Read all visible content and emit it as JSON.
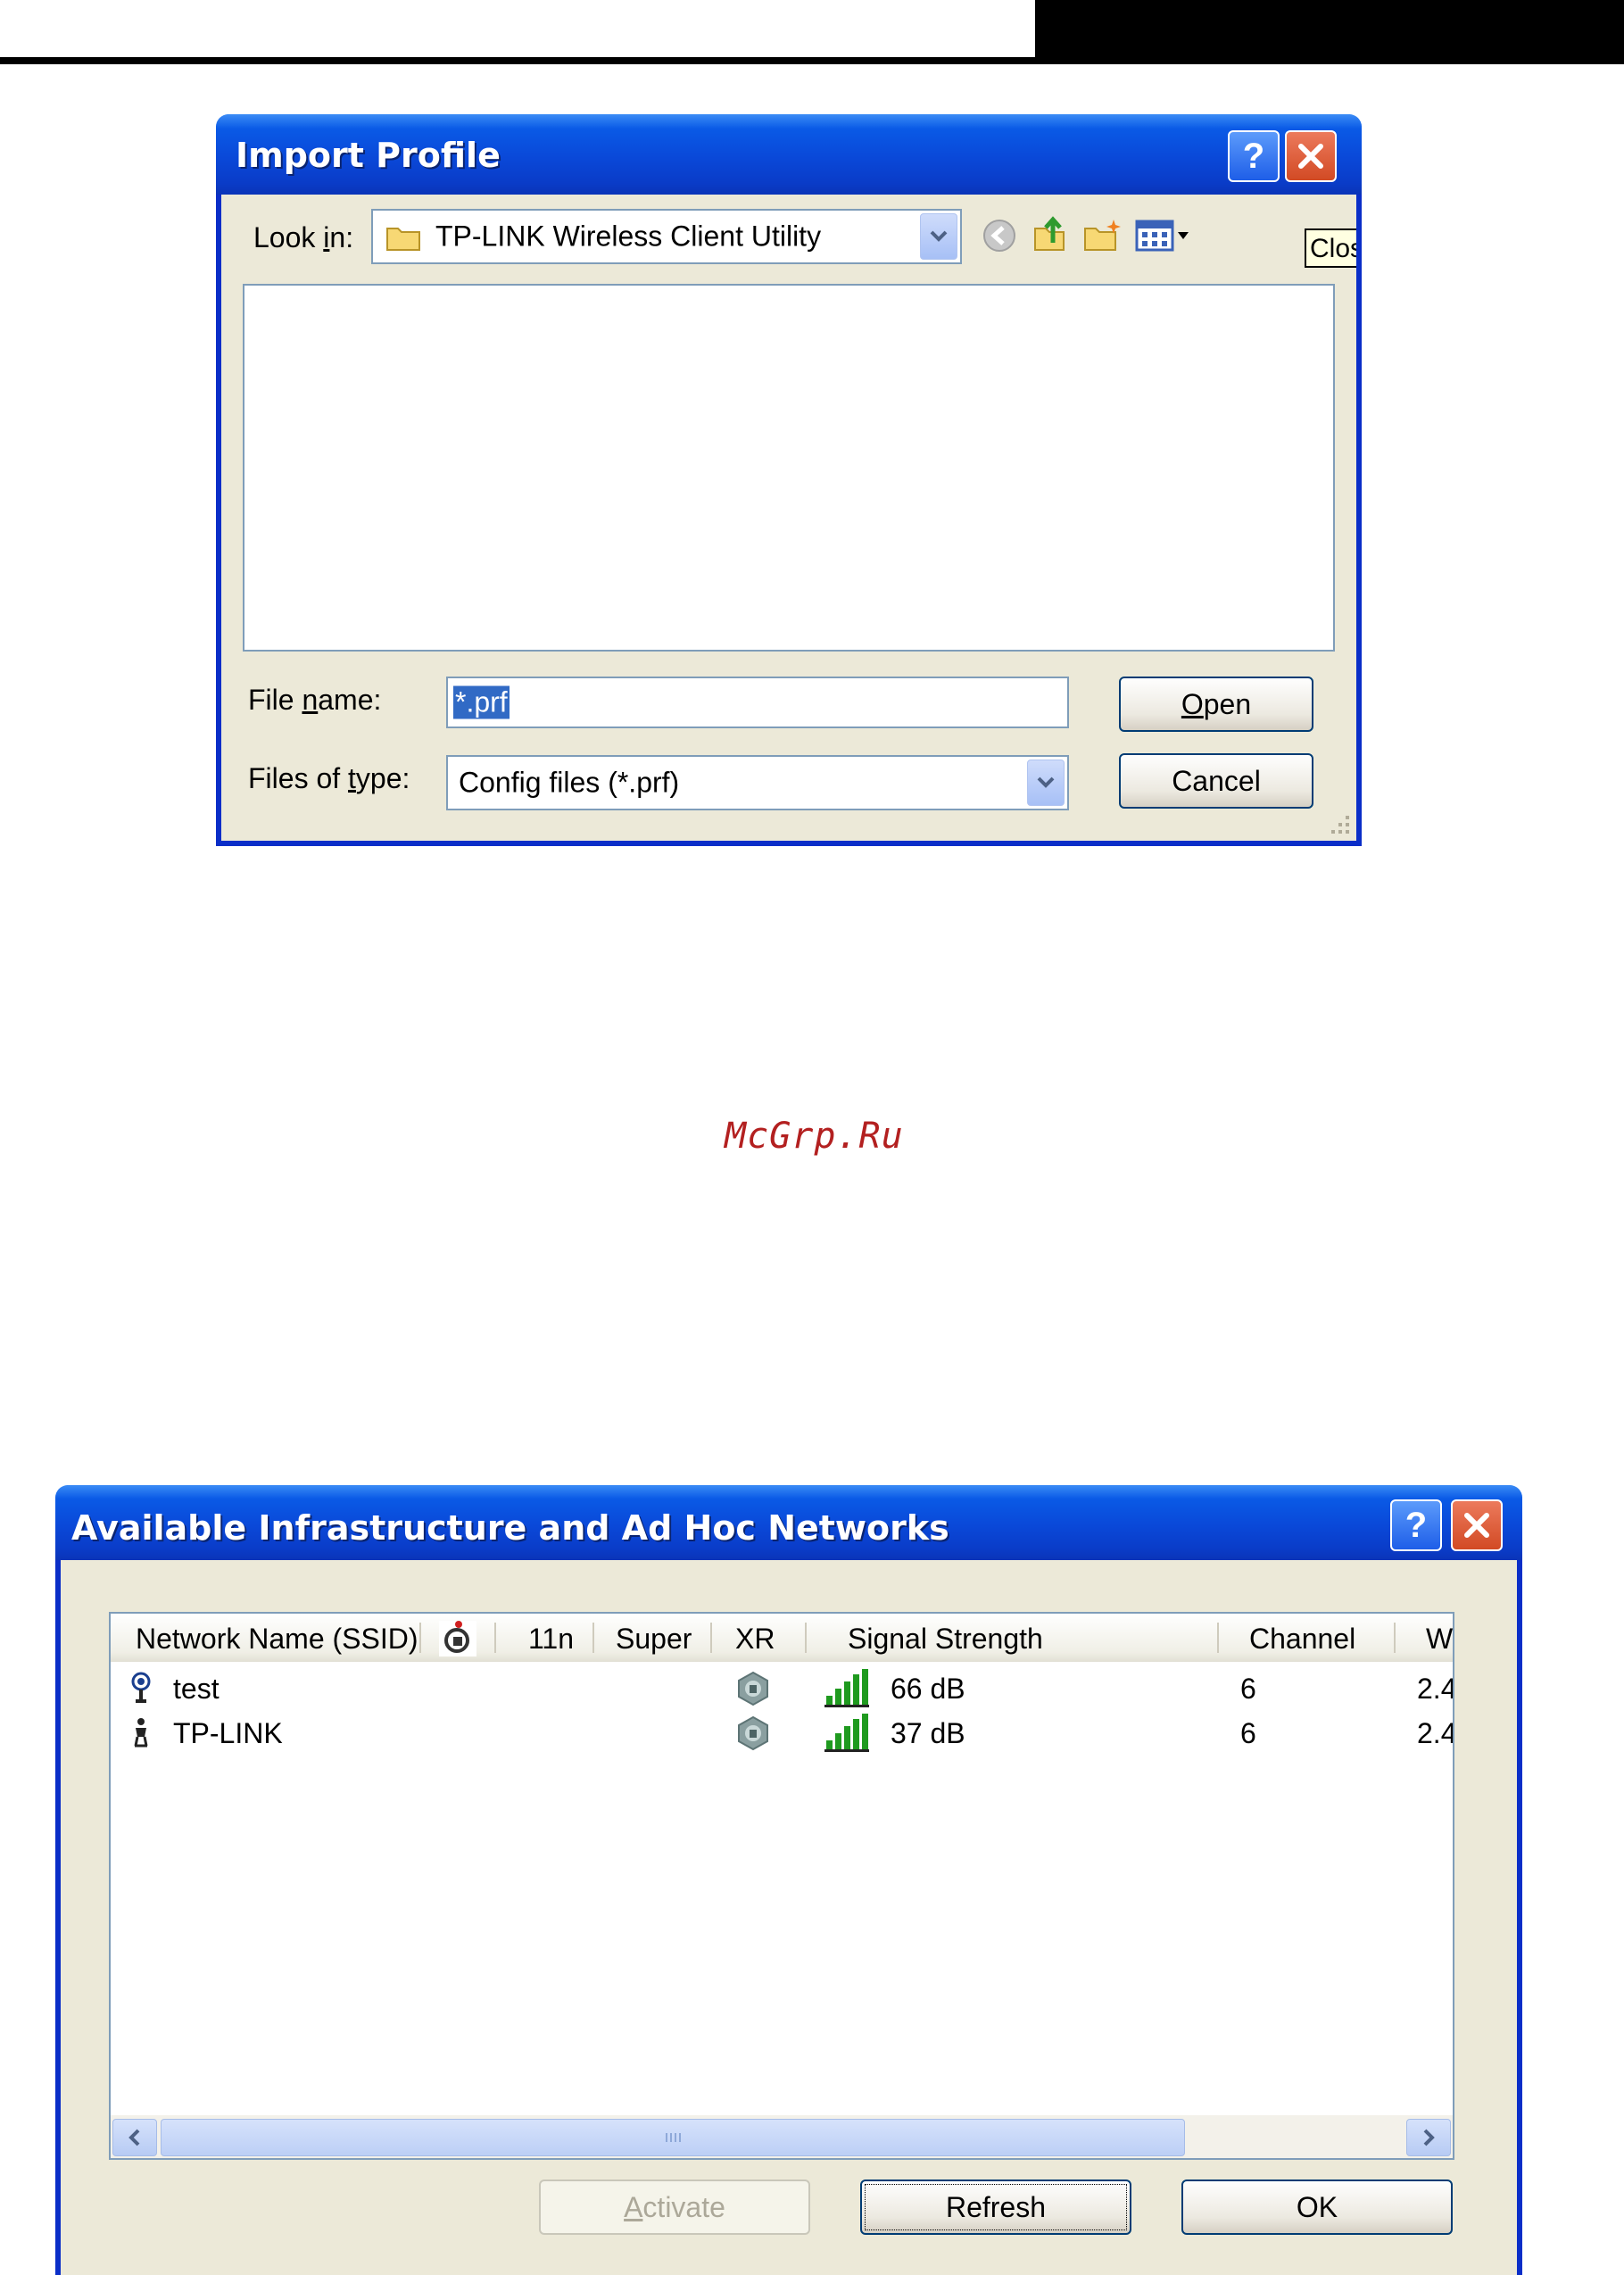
{
  "import_dialog": {
    "title": "Import Profile",
    "look_in_label": "Look in:",
    "look_in_value": "TP-LINK Wireless Client Utility",
    "tooltip_text": "Clos",
    "file_name_label": "File name:",
    "file_name_value": "*.prf",
    "files_of_type_label": "Files of type:",
    "files_of_type_value": "Config files (*.prf)",
    "open_label": "Open",
    "cancel_label": "Cancel",
    "toolbar_icons": [
      "back-icon",
      "up-folder-icon",
      "new-folder-icon",
      "view-menu-icon"
    ]
  },
  "watermark": "McGrp.Ru",
  "networks_dialog": {
    "title": "Available Infrastructure and Ad Hoc Networks",
    "columns": [
      "Network Name (SSID)",
      "",
      "11n",
      "Super",
      "XR",
      "Signal Strength",
      "Channel",
      "W"
    ],
    "rows": [
      {
        "network_type_icon": "infrastructure-icon",
        "ssid": "test",
        "security_icon": "security-icon",
        "signal_icon": "signal-bars-icon",
        "signal": "66 dB",
        "channel": "6",
        "wireless_mode": "2.4"
      },
      {
        "network_type_icon": "adhoc-icon",
        "ssid": "TP-LINK",
        "security_icon": "security-icon",
        "signal_icon": "signal-bars-icon",
        "signal": "37 dB",
        "channel": "6",
        "wireless_mode": "2.4"
      }
    ],
    "activate_label": "Activate",
    "refresh_label": "Refresh",
    "ok_label": "OK"
  }
}
